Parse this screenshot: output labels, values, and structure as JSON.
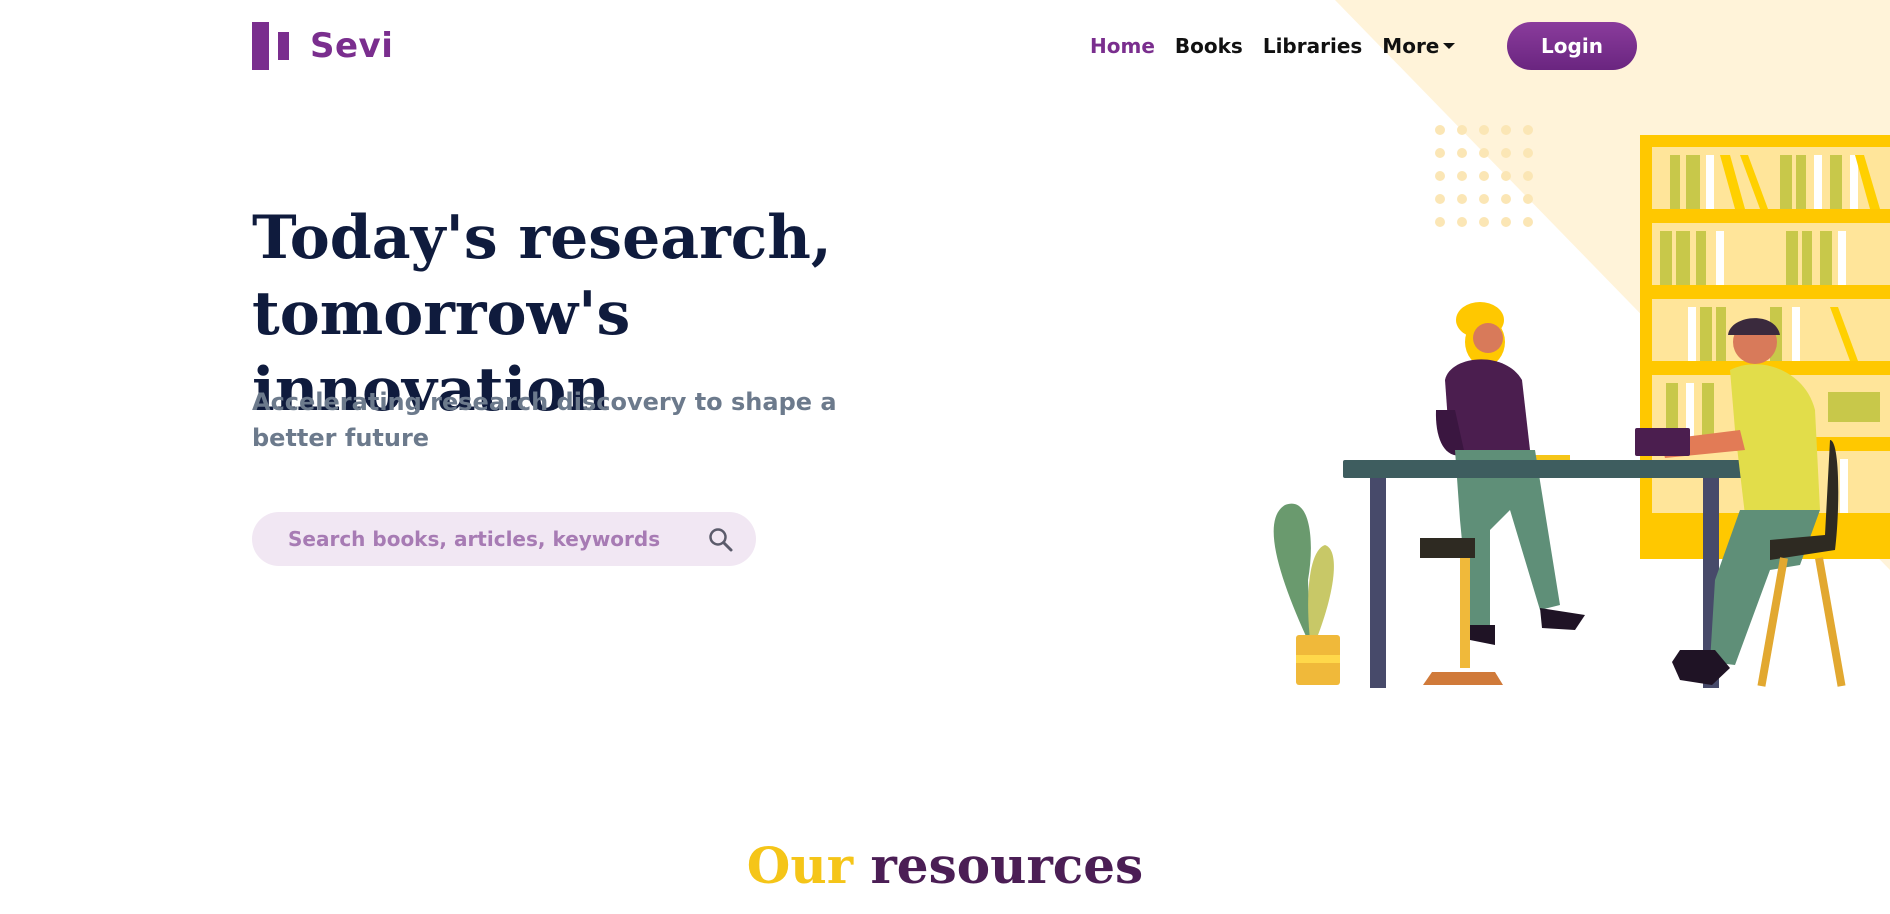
{
  "brand": {
    "name": "Sevi",
    "color": "#7a2e8e"
  },
  "nav": {
    "items": [
      {
        "label": "Home",
        "active": true
      },
      {
        "label": "Books",
        "active": false
      },
      {
        "label": "Libraries",
        "active": false
      },
      {
        "label": "More",
        "active": false,
        "dropdown": true
      }
    ],
    "login_label": "Login"
  },
  "hero": {
    "title_line1": "Today's research,",
    "title_line2": "tomorrow's innovation",
    "subtitle": "Accelerating research discovery to shape a better future",
    "search_placeholder": "Search books, articles, keywords",
    "search_icon": "search-icon"
  },
  "resources": {
    "word1": "Our",
    "word2": "resources"
  },
  "colors": {
    "primary": "#7a2e8e",
    "accent_yellow": "#f5c518",
    "heading_dark": "#0f1b3d",
    "subtitle_gray": "#6c7a8c",
    "search_bg": "#f1e7f3",
    "wedge": "#fff3d6"
  }
}
